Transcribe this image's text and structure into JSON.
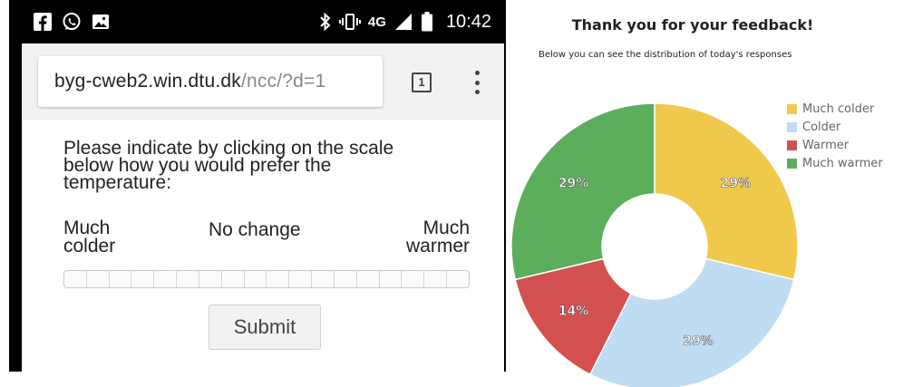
{
  "status_bar": {
    "network": "4G",
    "time": "10:42",
    "left_icons": [
      "facebook-icon",
      "whatsapp-icon",
      "image-icon"
    ],
    "right_icons": [
      "bluetooth-icon",
      "vibrate-icon",
      "signal-icon",
      "battery-icon"
    ]
  },
  "browser": {
    "url_host": "byg-cweb2.win.dtu.dk",
    "url_path": "/ncc/?d=1",
    "tab_count": "1"
  },
  "form": {
    "question_lines": [
      "Please indicate by clicking on the scale",
      "below how you would prefer the",
      "temperature:"
    ],
    "left_label_lines": [
      "Much",
      "colder"
    ],
    "middle_label": "No change",
    "right_label_lines": [
      "Much",
      "warmer"
    ],
    "scale_segments": 18,
    "submit_label": "Submit"
  },
  "chart_data": {
    "type": "pie",
    "variant": "donut",
    "title": "Thank you for your feedback!",
    "subtitle": "Below you can see the distribution of today's responses",
    "legend_position": "top-right",
    "series": [
      {
        "name": "Much colder",
        "value": 29,
        "label": "29%",
        "color": "#f0c84b"
      },
      {
        "name": "Colder",
        "value": 29,
        "label": "29%",
        "color": "#bfdcf3"
      },
      {
        "name": "Warmer",
        "value": 14,
        "label": "14%",
        "color": "#d45050"
      },
      {
        "name": "Much warmer",
        "value": 29,
        "label": "29%",
        "color": "#5cae5c"
      }
    ]
  }
}
